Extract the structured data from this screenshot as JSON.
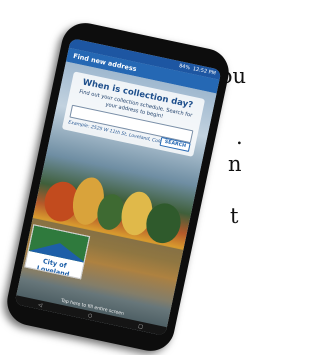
{
  "background_text": {
    "line1": "you",
    "line2": ".",
    "line3": "n",
    "line4": "t"
  },
  "status_bar": {
    "time": "12:52 PM",
    "battery": "84%"
  },
  "app_bar": {
    "title": "Find new address"
  },
  "card": {
    "title": "When is collection day?",
    "subtitle": "Find out your collection schedule. Search for your address to begin!",
    "search_placeholder": "",
    "example": "Example: 2525 W 11th St, Loveland, Colorado",
    "search_label": "SEARCH"
  },
  "logo": {
    "text": "City of Loveland"
  },
  "footer": {
    "hint": "Tap here to fill entire screen"
  },
  "nav": {
    "back": "◁",
    "home": "○",
    "recent": "□"
  },
  "colors": {
    "app_bar": "#2568b4",
    "status_bar": "#1d56a2",
    "title_text": "#1e4f8c"
  }
}
